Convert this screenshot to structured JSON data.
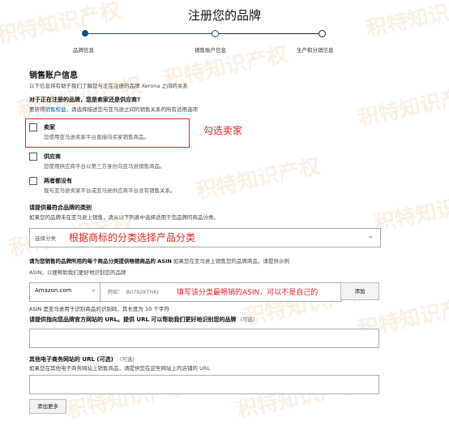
{
  "page": {
    "title": "注册您的品牌"
  },
  "steps": [
    {
      "label": "品牌信息"
    },
    {
      "label": "销售账户信息"
    },
    {
      "label": "生产和分销信息"
    }
  ],
  "section": {
    "title": "销售账户信息",
    "subtitle": "以下信息将有助于我们了解您与正在注册的品牌 Xerona 之间的关系"
  },
  "relation": {
    "question": "对于正在注册的品牌，您是卖家还是供应商?",
    "hint_prefix": "要获得",
    "hint_link": "销售权益",
    "hint_suffix": "，请选择描述您与亚马逊之间的销售关系的所有适用选项",
    "options": [
      {
        "title": "卖家",
        "desc": "您使用亚马逊卖家平台直接向买家销售商品。"
      },
      {
        "title": "供应商",
        "desc": "您使用供应商平台以第三方身份向亚马逊销售商品。"
      },
      {
        "title": "两者都没有",
        "desc": "我与亚马逊卖家平台或亚马逊供应商平台没有销售关系。"
      }
    ],
    "annotation": "勾选卖家"
  },
  "category": {
    "label": "请提供最符合品牌的类别",
    "hint": "如果您的品牌未在亚马逊上销售，请从以下列表中选择适用于您品牌的商品分类。",
    "placeholder": "选择分类",
    "annotation": "根据商标的分类选择产品分类"
  },
  "asin": {
    "label_bold": "请为您销售的品牌所用的每个商品分类提供畅销商品的 ASIN",
    "label_rest": " 如果您在亚马逊上销售您的品牌商品，请提供示例",
    "label_line2": "ASIN，以便帮助我们更好地识别您的品牌",
    "marketplace": "Amazon.com",
    "example_prefix": "例如：",
    "example_value": "B0792KTHKJ",
    "add_label": "添加",
    "annotation": "填写该分类最畅销的ASIN，可以不是自己的",
    "note": "ASIN 是亚马逊用于识别商品的识别码，其长度为 10 个字符"
  },
  "website": {
    "label": "请提供指向您品牌官方网站的 URL。提供 URL 可以帮助我们更好地识别您的品牌",
    "optional": "(可选)"
  },
  "other_sites": {
    "label": "其他电子商务网站的 URL (可选)",
    "optional": "(可选)",
    "hint": "如果您在其他电子商务网站上销售商品，请提供您在这些网站上的店铺的 URL",
    "add_more": "添加更多"
  },
  "watermark": {
    "text": "积特知识产权",
    "url": "www.jetdite.com"
  },
  "colors": {
    "accent": "#1f4a8a",
    "annotation": "#e02424",
    "link": "#0066c0"
  }
}
